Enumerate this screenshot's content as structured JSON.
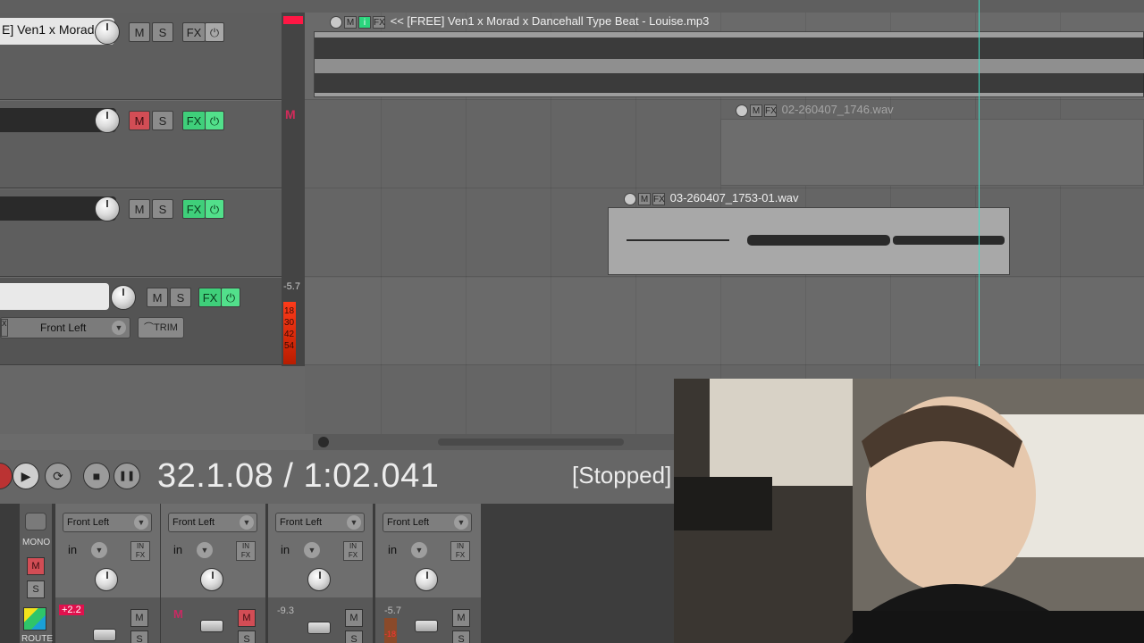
{
  "tracks": [
    {
      "name": "E] Ven1 x Morad",
      "mute": "M",
      "solo": "S",
      "fx": "FX",
      "power": "⏻",
      "mute_active": false,
      "fx_green": false
    },
    {
      "name": "",
      "mute": "M",
      "solo": "S",
      "fx": "FX",
      "power": "⏻",
      "mute_active": true,
      "fx_green": true
    },
    {
      "name": "",
      "mute": "M",
      "solo": "S",
      "fx": "FX",
      "power": "⏻",
      "mute_active": false,
      "fx_green": true
    },
    {
      "name": "",
      "mute": "M",
      "solo": "S",
      "fx": "FX",
      "power": "⏻",
      "mute_active": false,
      "fx_green": true,
      "io": "Front Left",
      "trim": "TRIM"
    }
  ],
  "io_x": "X",
  "meter": {
    "m_label": "M",
    "value": "-5.7",
    "ticks": [
      "18",
      "30",
      "42",
      "54"
    ]
  },
  "items": [
    {
      "title": "<< [FREE] Ven1 x Morad x Dancehall Type Beat - Louise.mp3",
      "m": "M",
      "i": "i",
      "fx": "FX"
    },
    {
      "title": "02-260407_1746.wav",
      "m": "M",
      "fx": "FX"
    },
    {
      "title": "03-260407_1753-01.wav",
      "m": "M",
      "fx": "FX"
    }
  ],
  "transport": {
    "time": "32.1.08 / 1:02.041",
    "status": "[Stopped]",
    "play": "▶",
    "repeat": "⟳",
    "stop": "■",
    "pause": "❚❚"
  },
  "mixer": {
    "mono_label": "MONO",
    "m": "M",
    "s": "S",
    "route": "ROUTE",
    "strips": [
      {
        "output": "Front Left",
        "input": "in",
        "infx_top": "IN",
        "infx_bottom": "FX",
        "db": "+2.2",
        "db_red": true,
        "m": "M",
        "s": "S",
        "m_active": false
      },
      {
        "output": "Front Left",
        "input": "in",
        "infx_top": "IN",
        "infx_bottom": "FX",
        "db": "",
        "db_red": false,
        "m": "M",
        "s": "S",
        "m_active": true
      },
      {
        "output": "Front Left",
        "input": "in",
        "infx_top": "IN",
        "infx_bottom": "FX",
        "db": "-9.3",
        "db_red": false,
        "m": "M",
        "s": "S",
        "m_active": false
      },
      {
        "output": "Front Left",
        "input": "in",
        "infx_top": "IN",
        "infx_bottom": "FX",
        "db": "-5.7",
        "db_red": false,
        "m": "M",
        "s": "S",
        "m_active": false,
        "meter": "-18"
      }
    ]
  },
  "colors": {
    "accent_green": "#3fcf7a",
    "mute_red": "#d24d55",
    "cursor": "#3ee0c6",
    "clip_red": "#ff1744"
  }
}
